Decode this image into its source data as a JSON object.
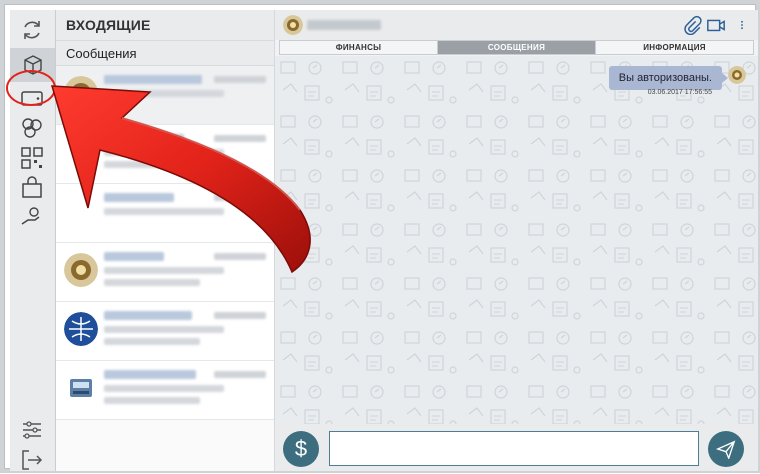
{
  "inbox": {
    "title": "ВХОДЯЩИЕ",
    "subtitle": "Сообщения"
  },
  "chat": {
    "tabs": [
      {
        "label": "ФИНАНСЫ",
        "active": false
      },
      {
        "label": "СООБЩЕНИЯ",
        "active": true
      },
      {
        "label": "ИНФОРМАЦИЯ",
        "active": false
      }
    ],
    "message": {
      "text": "Вы авторизованы.",
      "timestamp": "03.06.2017 17:56:55"
    },
    "input_value": ""
  },
  "icons": {
    "rail": [
      "refresh-icon",
      "box-icon",
      "wallet-icon",
      "coins-icon",
      "qr-code-icon",
      "shopping-bag-icon",
      "hand-coin-icon",
      "settings-sliders-icon",
      "logout-icon"
    ],
    "topbar": [
      "paperclip-icon",
      "video-camera-icon",
      "more-vertical-icon"
    ],
    "composer": [
      "dollar-icon",
      "send-icon"
    ]
  },
  "colors": {
    "accent": "#3d6e80",
    "bubble": "#aab7d3",
    "active_tab": "#9aa0a6",
    "annotation_red": "#e2231a"
  }
}
